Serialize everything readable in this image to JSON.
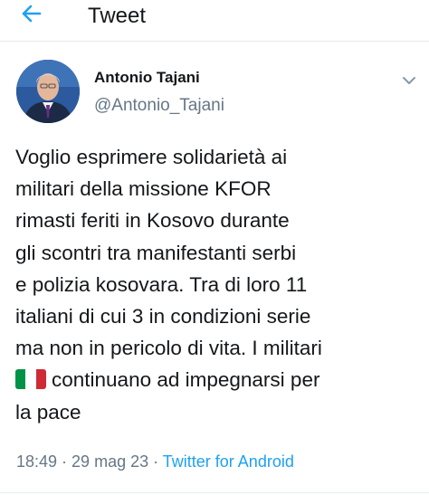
{
  "header": {
    "back_icon": "arrow-left-icon",
    "title": "Tweet"
  },
  "tweet": {
    "author": {
      "name": "Antonio Tajani",
      "handle": "@Antonio_Tajani",
      "avatar": "avatar-photo"
    },
    "more_icon": "chevron-down-icon",
    "lines": [
      "Voglio esprimere solidarietà ai",
      "militari della missione KFOR",
      "rimasti feriti in Kosovo durante",
      "gli scontri tra manifestanti serbi",
      "e polizia kosovara. Tra di loro 11",
      "italiani di cui 3 in condizioni serie",
      "ma non in pericolo di vita. I militari",
      "continuano ad impegnarsi per",
      "la pace"
    ],
    "flag_icon": "italy-flag-icon",
    "meta": {
      "time": "18:49",
      "separator": " · ",
      "date": "29 mag 23",
      "source": "Twitter for Android"
    }
  },
  "colors": {
    "accent": "#1da1f2",
    "text_primary": "#14171a",
    "text_secondary": "#657786",
    "flag_green": "#009246",
    "flag_white": "#ffffff",
    "flag_red": "#ce2b37"
  }
}
